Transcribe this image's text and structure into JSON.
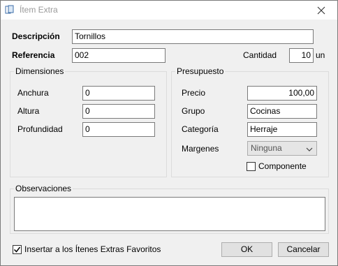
{
  "window": {
    "title": "Ítem Extra",
    "app_icon": "dialog-icon",
    "close_icon": "close-icon"
  },
  "header": {
    "descripcion_label": "Descripción",
    "descripcion_value": "Tornillos",
    "referencia_label": "Referencia",
    "referencia_value": "002",
    "cantidad_label": "Cantidad",
    "cantidad_value": "10",
    "cantidad_unit": "un"
  },
  "dimensiones": {
    "title": "Dimensiones",
    "fields": [
      {
        "label": "Anchura",
        "value": "0"
      },
      {
        "label": "Altura",
        "value": "0"
      },
      {
        "label": "Profundidad",
        "value": "0"
      }
    ]
  },
  "presupuesto": {
    "title": "Presupuesto",
    "precio_label": "Precio",
    "precio_value": "100,00",
    "grupo_label": "Grupo",
    "grupo_value": "Cocinas",
    "categoria_label": "Categoría",
    "categoria_value": "Herraje",
    "margenes_label": "Margenes",
    "margenes_value": "Ninguna",
    "componente_label": "Componente",
    "componente_checked": false
  },
  "observaciones": {
    "title": "Observaciones",
    "value": ""
  },
  "footer": {
    "favoritos_label": "Insertar a los Ítenes Extras Favoritos",
    "favoritos_checked": true,
    "ok_label": "OK",
    "cancel_label": "Cancelar"
  }
}
